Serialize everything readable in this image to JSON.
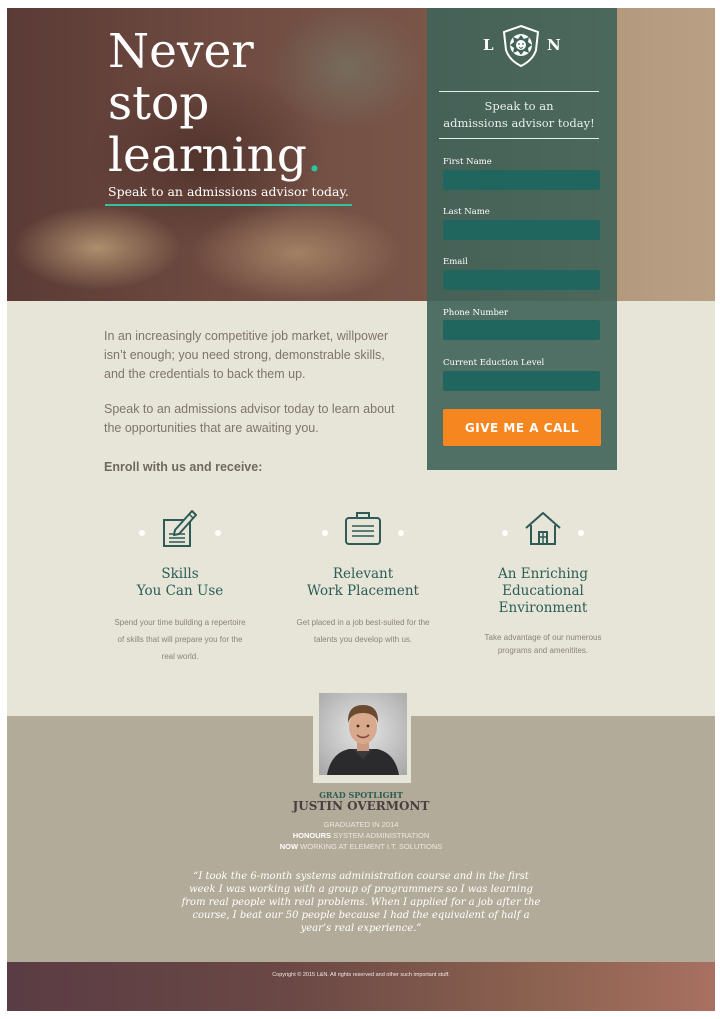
{
  "hero": {
    "title_line1": "Never",
    "title_line2": "stop",
    "title_line3": "learning",
    "title_dot": ".",
    "subtitle": "Speak to an admissions advisor today."
  },
  "brand": {
    "logo_left": "L",
    "logo_right": "N",
    "emblem_icon": "lion-shield-icon",
    "accent_color": "#2bc5a4",
    "panel_color": "#406359",
    "field_color": "#21665e",
    "cta_color": "#f6861f"
  },
  "form": {
    "heading_line1": "Speak to an",
    "heading_line2": "admissions advisor today!",
    "fields": [
      {
        "label": "First Name",
        "value": ""
      },
      {
        "label": "Last Name",
        "value": ""
      },
      {
        "label": "Email",
        "value": ""
      },
      {
        "label": "Phone Number",
        "value": ""
      },
      {
        "label": "Current Eduction Level",
        "value": ""
      }
    ],
    "submit_label": "GIVE ME A CALL"
  },
  "intro": {
    "paragraph1": "In an increasingly competitive job market, willpower isn’t enough; you need strong, demonstrable skills, and the credentials to back them up.",
    "paragraph2": "Speak to an admissions advisor today to learn about the opportunities that are awaiting you.",
    "enroll": "Enroll with us and receive:"
  },
  "features": [
    {
      "icon": "pencil-paper-icon",
      "title_line1": "Skills",
      "title_line2": "You Can Use",
      "title_line3": "",
      "text": "Spend your time building a repertoire of skills that will prepare you for the real world."
    },
    {
      "icon": "briefcase-icon",
      "title_line1": "Relevant",
      "title_line2": "Work Placement",
      "title_line3": "",
      "text": "Get placed in a job best-suited for the talents you develop with us."
    },
    {
      "icon": "house-icon",
      "title_line1": "An Enriching",
      "title_line2": "Educational",
      "title_line3": "Environment",
      "text": "Take advantage of our numerous programs and amenitites."
    }
  ],
  "spotlight": {
    "label": "GRAD SPOTLIGHT",
    "name": "JUSTIN OVERMONT",
    "graduated": "GRADUATED IN 2014",
    "honours_key": "HONOURS",
    "honours_value": "SYSTEM ADMINISTRATION",
    "now_key": "NOW",
    "now_value": "WORKING AT ELEMENT I.T. SOLUTIONS",
    "quote": "“I took the 6-month systems administration course and in the first week I was working with a group of programmers so I was learning from real people with real problems. When I applied for a job after the course, I beat our 50 people because I had the equivalent of half a year’s real experience.”"
  },
  "footer": {
    "copyright": "Copyright © 2015 L&N. All rights reserved and other such important stuff."
  }
}
